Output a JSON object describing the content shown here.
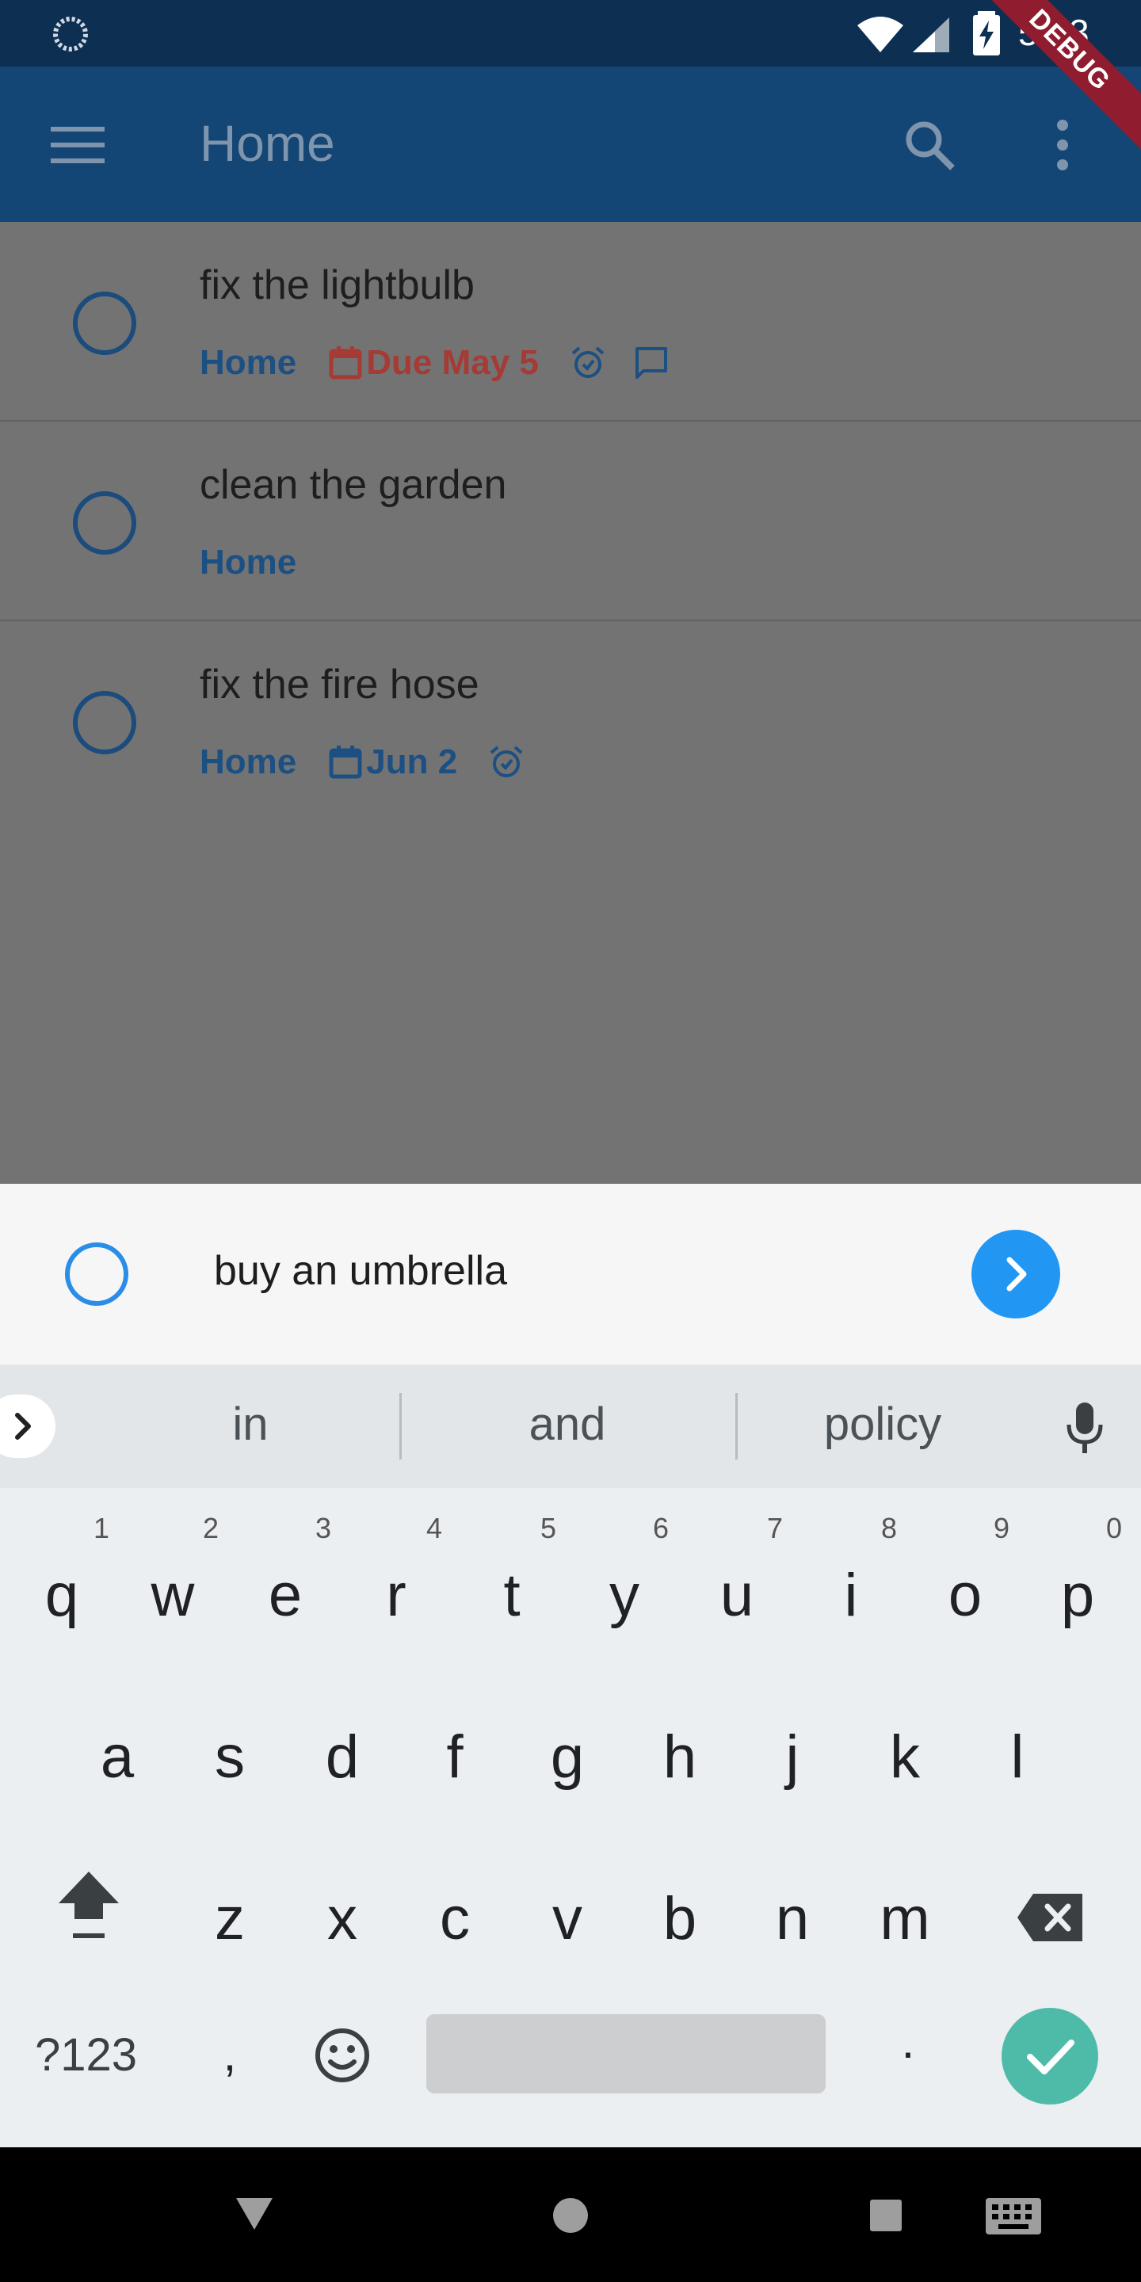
{
  "status_bar": {
    "time": "5:03",
    "debug_label": "DEBUG",
    "icons": [
      "loading-spinner-icon",
      "wifi-icon",
      "signal-icon",
      "battery-charging-icon"
    ]
  },
  "appbar": {
    "title": "Home",
    "icons": [
      "menu-icon",
      "search-icon",
      "more-vert-icon"
    ]
  },
  "tasks": [
    {
      "title": "fix the lightbulb",
      "project": "Home",
      "due": "Due May 5",
      "due_color": "#a63a35",
      "has_alarm": true,
      "has_comment": true
    },
    {
      "title": "clean the garden",
      "project": "Home",
      "due": "",
      "has_alarm": false,
      "has_comment": false
    },
    {
      "title": "fix the fire hose",
      "project": "Home",
      "due": "Jun 2",
      "due_color": "#1c4f82",
      "has_alarm": true,
      "has_comment": false
    }
  ],
  "composer": {
    "value": "buy an umbrella"
  },
  "keyboard": {
    "suggestions": [
      "in",
      "and",
      "policy"
    ],
    "row1": [
      {
        "key": "q",
        "hint": "1"
      },
      {
        "key": "w",
        "hint": "2"
      },
      {
        "key": "e",
        "hint": "3"
      },
      {
        "key": "r",
        "hint": "4"
      },
      {
        "key": "t",
        "hint": "5"
      },
      {
        "key": "y",
        "hint": "6"
      },
      {
        "key": "u",
        "hint": "7"
      },
      {
        "key": "i",
        "hint": "8"
      },
      {
        "key": "o",
        "hint": "9"
      },
      {
        "key": "p",
        "hint": "0"
      }
    ],
    "row2": [
      "a",
      "s",
      "d",
      "f",
      "g",
      "h",
      "j",
      "k",
      "l"
    ],
    "row3": [
      "z",
      "x",
      "c",
      "v",
      "b",
      "n",
      "m"
    ],
    "symbols_label": "?123",
    "comma": ",",
    "period": "."
  },
  "colors": {
    "primary_dark": "#0d2f52",
    "primary": "#134575",
    "accent": "#2196f3",
    "enter": "#4ebba8"
  }
}
